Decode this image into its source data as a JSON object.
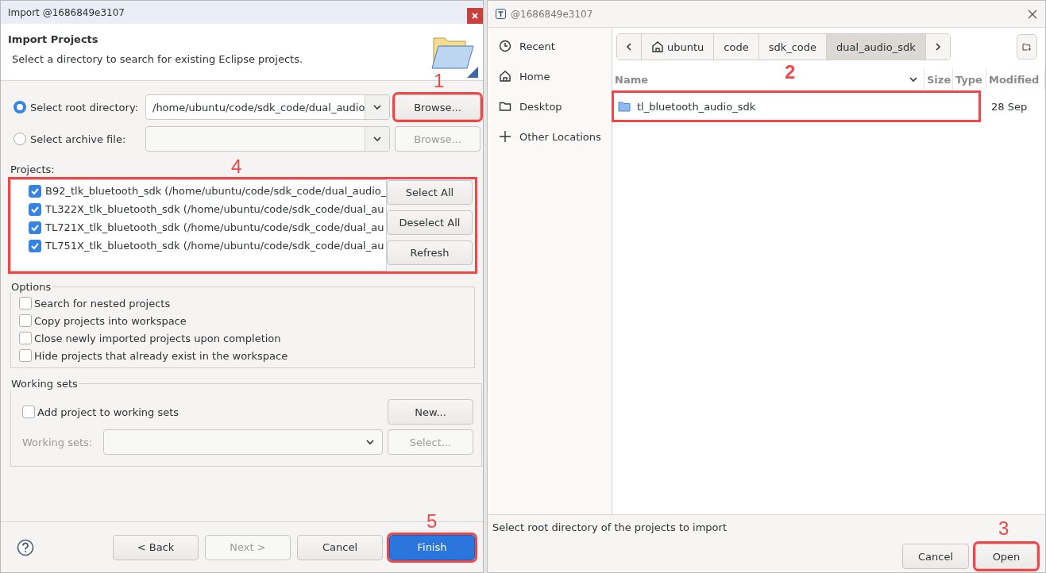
{
  "import_dialog": {
    "title": "Import @1686849e3107",
    "header": {
      "title": "Import Projects",
      "description": "Select a directory to search for existing Eclipse projects."
    },
    "sources": [
      {
        "label": "Select root directory:",
        "selected": true,
        "value": "/home/ubuntu/code/sdk_code/dual_audio",
        "browse": {
          "label": "Browse...",
          "disabled": false,
          "annotation": "1"
        }
      },
      {
        "label": "Select archive file:",
        "selected": false,
        "browse": {
          "label": "Browse...",
          "disabled": true
        }
      }
    ],
    "projects_label": "Projects:",
    "projects_annotation": "4",
    "projects": [
      {
        "name": "B92_tlk_bluetooth_sdk (/home/ubuntu/code/sdk_code/dual_audio_",
        "checked": true
      },
      {
        "name": "TL322X_tlk_bluetooth_sdk (/home/ubuntu/code/sdk_code/dual_au",
        "checked": true
      },
      {
        "name": "TL721X_tlk_bluetooth_sdk (/home/ubuntu/code/sdk_code/dual_au",
        "checked": true
      },
      {
        "name": "TL751X_tlk_bluetooth_sdk (/home/ubuntu/code/sdk_code/dual_au",
        "checked": true
      }
    ],
    "list_buttons": [
      "Select All",
      "Deselect All",
      "Refresh"
    ],
    "options": {
      "title": "Options",
      "items": [
        {
          "label": "Search for nested projects",
          "checked": false
        },
        {
          "label": "Copy projects into workspace",
          "checked": false
        },
        {
          "label": "Close newly imported projects upon completion",
          "checked": false
        },
        {
          "label": "Hide projects that already exist in the workspace",
          "checked": false
        }
      ]
    },
    "working_sets": {
      "title": "Working sets",
      "add_label": "Add project to working sets",
      "add_checked": false,
      "new_label": "New...",
      "sets_label": "Working sets:",
      "select_label": "Select..."
    },
    "buttons": [
      {
        "label": "< Back",
        "kind": "normal"
      },
      {
        "label": "Next >",
        "kind": "disabled"
      },
      {
        "label": "Cancel",
        "kind": "normal"
      },
      {
        "label": "Finish",
        "kind": "primary",
        "annotation": "5"
      }
    ]
  },
  "file_chooser": {
    "title": "@1686849e3107",
    "places": [
      {
        "label": "Recent",
        "kind": "clock"
      },
      {
        "label": "Home",
        "kind": "home"
      },
      {
        "label": "Desktop",
        "kind": "folder"
      },
      {
        "label": "Other Locations",
        "kind": "plus"
      }
    ],
    "path": [
      {
        "label": "ubuntu",
        "selected": false,
        "kind": "home"
      },
      {
        "label": "code",
        "selected": false,
        "kind": "plain"
      },
      {
        "label": "sdk_code",
        "selected": false,
        "kind": "plain"
      },
      {
        "label": "dual_audio_sdk",
        "selected": true,
        "kind": "plain"
      }
    ],
    "columns": [
      "Name",
      "Size",
      "Type",
      "Modified"
    ],
    "columns_annotation": "2",
    "rows": [
      {
        "name": "tl_bluetooth_audio_sdk",
        "modified": "28 Sep",
        "highlighted": true
      }
    ],
    "status": "Select root directory of the projects to import",
    "buttons": [
      {
        "label": "Cancel"
      },
      {
        "label": "Open",
        "annotation": "3"
      }
    ]
  }
}
